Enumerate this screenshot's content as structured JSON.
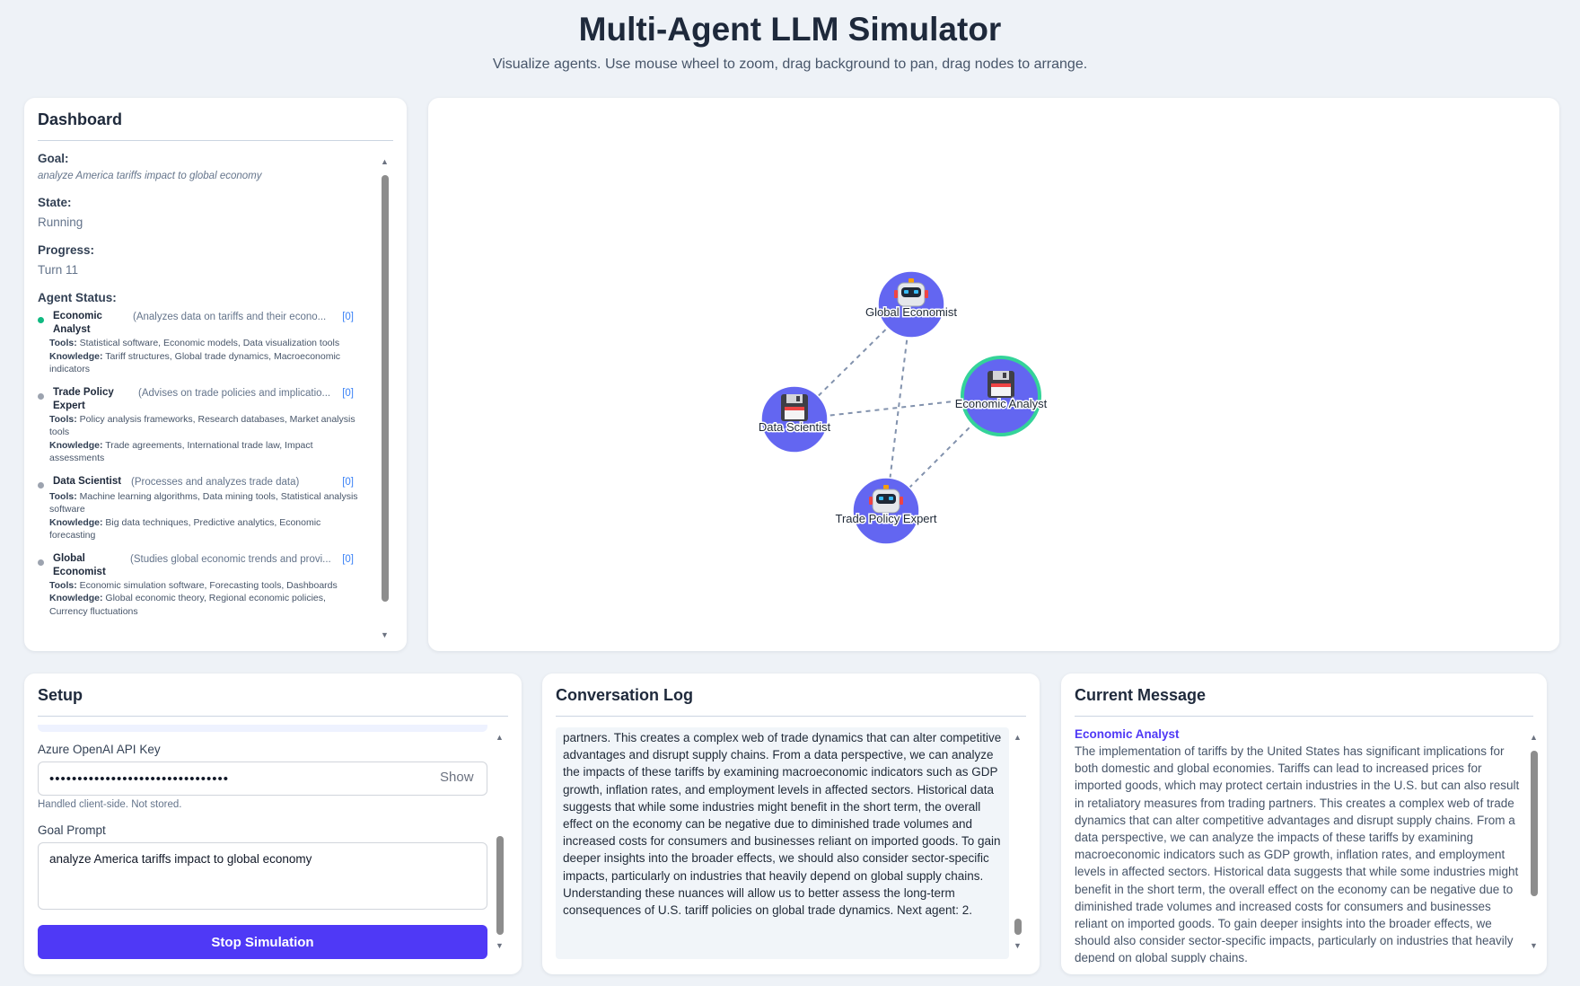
{
  "header": {
    "title": "Multi-Agent LLM Simulator",
    "subtitle": "Visualize agents. Use mouse wheel to zoom, drag background to pan, drag nodes to arrange."
  },
  "dashboard": {
    "title": "Dashboard",
    "goal_label": "Goal:",
    "goal_value": "analyze America tariffs impact to global economy",
    "state_label": "State:",
    "state_value": "Running",
    "progress_label": "Progress:",
    "progress_value": "Turn 11",
    "agent_status_label": "Agent Status:",
    "agents": [
      {
        "name": "Economic Analyst",
        "description": "(Analyzes data on tariffs and their econo...",
        "count": "[0]",
        "status_color": "#10b981",
        "tools_label": "Tools:",
        "tools": "Statistical software, Economic models, Data visualization tools",
        "knowledge_label": "Knowledge:",
        "knowledge": "Tariff structures, Global trade dynamics, Macroeconomic indicators"
      },
      {
        "name": "Trade Policy Expert",
        "description": "(Advises on trade policies and implicatio...",
        "count": "[0]",
        "status_color": "#9ca3af",
        "tools_label": "Tools:",
        "tools": "Policy analysis frameworks, Research databases, Market analysis tools",
        "knowledge_label": "Knowledge:",
        "knowledge": "Trade agreements, International trade law, Impact assessments"
      },
      {
        "name": "Data Scientist",
        "description": "(Processes and analyzes trade data)",
        "count": "[0]",
        "status_color": "#9ca3af",
        "tools_label": "Tools:",
        "tools": "Machine learning algorithms, Data mining tools, Statistical analysis software",
        "knowledge_label": "Knowledge:",
        "knowledge": "Big data techniques, Predictive analytics, Economic forecasting"
      },
      {
        "name": "Global Economist",
        "description": "(Studies global economic trends and provi...",
        "count": "[0]",
        "status_color": "#9ca3af",
        "tools_label": "Tools:",
        "tools": "Economic simulation software, Forecasting tools, Dashboards",
        "knowledge_label": "Knowledge:",
        "knowledge": "Global economic theory, Regional economic policies, Currency fluctuations"
      }
    ]
  },
  "graph": {
    "node_color": "#6366f1",
    "active_ring_color": "#34d399",
    "nodes": [
      {
        "id": "global-economist",
        "label": "Global Economist",
        "icon": "robot-icon",
        "active": false
      },
      {
        "id": "economic-analyst",
        "label": "Economic Analyst",
        "icon": "floppy-disk-icon",
        "active": true
      },
      {
        "id": "data-scientist",
        "label": "Data Scientist",
        "icon": "floppy-disk-icon",
        "active": false
      },
      {
        "id": "trade-policy-expert",
        "label": "Trade Policy Expert",
        "icon": "robot-icon",
        "active": false
      }
    ],
    "links": [
      [
        "global-economist",
        "data-scientist"
      ],
      [
        "global-economist",
        "trade-policy-expert"
      ],
      [
        "data-scientist",
        "economic-analyst"
      ],
      [
        "economic-analyst",
        "trade-policy-expert"
      ]
    ]
  },
  "setup": {
    "title": "Setup",
    "api_key_label": "Azure OpenAI API Key",
    "api_key_value": "••••••••••••••••••••••••••••••••",
    "show_label": "Show",
    "api_hint": "Handled client-side. Not stored.",
    "goal_label": "Goal Prompt",
    "goal_value": "analyze America tariffs impact to global economy",
    "stop_label": "Stop Simulation",
    "accent_color": "#4f39f6"
  },
  "conversation": {
    "title": "Conversation Log",
    "text": "partners. This creates a complex web of trade dynamics that can alter competitive advantages and disrupt supply chains. From a data perspective, we can analyze the impacts of these tariffs by examining macroeconomic indicators such as GDP growth, inflation rates, and employment levels in affected sectors. Historical data suggests that while some industries might benefit in the short term, the overall effect on the economy can be negative due to diminished trade volumes and increased costs for consumers and businesses reliant on imported goods. To gain deeper insights into the broader effects, we should also consider sector-specific impacts, particularly on industries that heavily depend on global supply chains. Understanding these nuances will allow us to better assess the long-term consequences of U.S. tariff policies on global trade dynamics. Next agent: 2."
  },
  "current_message": {
    "title": "Current Message",
    "agent": "Economic Analyst",
    "text": "The implementation of tariffs by the United States has significant implications for both domestic and global economies. Tariffs can lead to increased prices for imported goods, which may protect certain industries in the U.S. but can also result in retaliatory measures from trading partners. This creates a complex web of trade dynamics that can alter competitive advantages and disrupt supply chains. From a data perspective, we can analyze the impacts of these tariffs by examining macroeconomic indicators such as GDP growth, inflation rates, and employment levels in affected sectors. Historical data suggests that while some industries might benefit in the short term, the overall effect on the economy can be negative due to diminished trade volumes and increased costs for consumers and businesses reliant on imported goods. To gain deeper insights into the broader effects, we should also consider sector-specific impacts, particularly on industries that heavily depend on global supply chains."
  }
}
